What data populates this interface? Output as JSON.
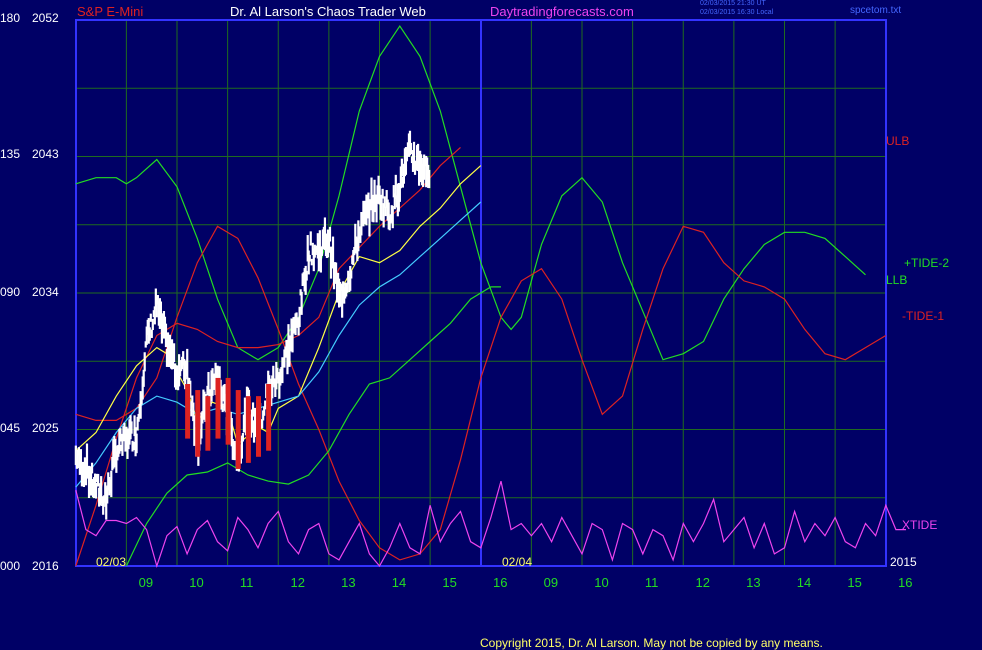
{
  "header": {
    "symbol": "S&P E-Mini",
    "site_title": "Dr. Al Larson's Chaos Trader Web",
    "site_url": "Daytradingforecasts.com",
    "stamp_line1": "02/03/2015 21:30 UT",
    "stamp_line2": "02/03/2015 16:30 Local",
    "file_name": "spcetom.txt"
  },
  "footer": {
    "copyright": "Copyright 2015, Dr. Al Larson. May not be copied by any means."
  },
  "colors": {
    "background": "#000066",
    "grid": "#1f6b1f",
    "frame": "#3333ff",
    "green": "#22dd22",
    "red": "#dd2222",
    "magenta": "#ee44ee",
    "cyan": "#44ccff",
    "yellow": "#ffff44",
    "white": "#ffffff"
  },
  "chart_data": {
    "type": "line",
    "left_axis_labels": [
      {
        "y": 0,
        "label": "000",
        "price": "2016"
      },
      {
        "y": 45,
        "label": "045",
        "price": "2025"
      },
      {
        "y": 90,
        "label": "090",
        "price": "2034"
      },
      {
        "y": 135,
        "label": "135",
        "price": "2043"
      },
      {
        "y": 180,
        "label": "180",
        "price": "2052"
      }
    ],
    "ylim": [
      0,
      180
    ],
    "price_range": [
      2016,
      2052
    ],
    "x_ticks": [
      "09",
      "10",
      "11",
      "12",
      "13",
      "14",
      "15",
      "16",
      "09",
      "10",
      "11",
      "12",
      "13",
      "14",
      "15",
      "16"
    ],
    "date_labels": [
      {
        "t": 0,
        "label": "02/03"
      },
      {
        "t": 8,
        "label": "02/04"
      }
    ],
    "year_label": "2015",
    "xlim": [
      0,
      16
    ],
    "series_labels": [
      {
        "name": "ULB",
        "color": "red"
      },
      {
        "name": "+TIDE-2",
        "color": "green"
      },
      {
        "name": "LLB",
        "color": "green"
      },
      {
        "name": "-TIDE-1",
        "color": "red"
      },
      {
        "name": "XTIDE",
        "color": "magenta"
      }
    ],
    "series": [
      {
        "key": "tide2",
        "color": "green",
        "points": [
          [
            -0.4,
            126
          ],
          [
            0,
            128
          ],
          [
            0.4,
            128
          ],
          [
            0.6,
            126
          ],
          [
            0.8,
            128
          ],
          [
            1.2,
            134
          ],
          [
            1.6,
            125
          ],
          [
            2,
            108
          ],
          [
            2.4,
            88
          ],
          [
            2.8,
            72
          ],
          [
            3.2,
            68
          ],
          [
            3.6,
            72
          ],
          [
            4,
            82
          ],
          [
            4.4,
            98
          ],
          [
            4.8,
            122
          ],
          [
            5.2,
            150
          ],
          [
            5.6,
            168
          ],
          [
            6,
            178
          ],
          [
            6.4,
            168
          ],
          [
            6.8,
            150
          ],
          [
            7.2,
            125
          ],
          [
            7.6,
            100
          ],
          [
            8,
            82
          ],
          [
            8.2,
            78
          ],
          [
            8.4,
            82
          ],
          [
            8.8,
            106
          ],
          [
            9.2,
            122
          ],
          [
            9.6,
            128
          ],
          [
            10,
            120
          ],
          [
            10.4,
            100
          ],
          [
            10.8,
            84
          ],
          [
            11.2,
            68
          ],
          [
            11.6,
            70
          ],
          [
            12,
            74
          ],
          [
            12.4,
            88
          ],
          [
            12.8,
            98
          ],
          [
            13.2,
            106
          ],
          [
            13.6,
            110
          ],
          [
            14,
            110
          ],
          [
            14.4,
            108
          ],
          [
            14.8,
            102
          ],
          [
            15.2,
            96
          ]
        ]
      },
      {
        "key": "tide1",
        "color": "red",
        "points": [
          [
            -0.4,
            50
          ],
          [
            0,
            48
          ],
          [
            0.4,
            48
          ],
          [
            0.8,
            52
          ],
          [
            1.2,
            62
          ],
          [
            1.6,
            82
          ],
          [
            2,
            100
          ],
          [
            2.4,
            112
          ],
          [
            2.8,
            108
          ],
          [
            3.2,
            95
          ],
          [
            3.6,
            78
          ],
          [
            4,
            60
          ],
          [
            4.4,
            45
          ],
          [
            4.8,
            28
          ],
          [
            5.2,
            15
          ],
          [
            5.6,
            6
          ],
          [
            6,
            2
          ],
          [
            6.4,
            4
          ],
          [
            6.8,
            12
          ],
          [
            7.2,
            35
          ],
          [
            7.6,
            62
          ],
          [
            8,
            82
          ],
          [
            8.4,
            94
          ],
          [
            8.8,
            98
          ],
          [
            9.2,
            88
          ],
          [
            9.6,
            68
          ],
          [
            10,
            50
          ],
          [
            10.4,
            56
          ],
          [
            10.8,
            78
          ],
          [
            11.2,
            98
          ],
          [
            11.6,
            112
          ],
          [
            12,
            110
          ],
          [
            12.4,
            100
          ],
          [
            12.8,
            94
          ],
          [
            13.2,
            92
          ],
          [
            13.6,
            88
          ],
          [
            14,
            78
          ],
          [
            14.4,
            70
          ],
          [
            14.8,
            68
          ],
          [
            15.2,
            72
          ],
          [
            15.6,
            76
          ]
        ]
      },
      {
        "key": "ulb",
        "color": "red",
        "points": [
          [
            -0.4,
            0
          ],
          [
            0,
            20
          ],
          [
            0.4,
            42
          ],
          [
            0.8,
            62
          ],
          [
            1.2,
            76
          ],
          [
            1.6,
            80
          ],
          [
            2,
            78
          ],
          [
            2.4,
            74
          ],
          [
            2.8,
            72
          ],
          [
            3.2,
            72
          ],
          [
            3.6,
            73
          ],
          [
            4,
            76
          ],
          [
            4.4,
            82
          ],
          [
            4.8,
            98
          ],
          [
            5.2,
            105
          ],
          [
            5.6,
            112
          ],
          [
            6,
            118
          ],
          [
            6.4,
            124
          ],
          [
            6.8,
            132
          ],
          [
            7.2,
            138
          ]
        ]
      },
      {
        "key": "llb",
        "color": "green",
        "points": [
          [
            0.6,
            0
          ],
          [
            1,
            14
          ],
          [
            1.4,
            24
          ],
          [
            1.8,
            30
          ],
          [
            2.2,
            31
          ],
          [
            2.6,
            34
          ],
          [
            3,
            30
          ],
          [
            3.4,
            28
          ],
          [
            3.8,
            27
          ],
          [
            4.2,
            30
          ],
          [
            4.6,
            38
          ],
          [
            5,
            50
          ],
          [
            5.4,
            60
          ],
          [
            5.8,
            62
          ],
          [
            6.2,
            68
          ],
          [
            6.6,
            74
          ],
          [
            7,
            80
          ],
          [
            7.4,
            88
          ],
          [
            7.8,
            92
          ],
          [
            8,
            92
          ]
        ]
      },
      {
        "key": "xtide",
        "color": "magenta",
        "points": [
          [
            -0.4,
            25
          ],
          [
            -0.2,
            12
          ],
          [
            0,
            10
          ],
          [
            0.2,
            15
          ],
          [
            0.4,
            15
          ],
          [
            0.6,
            14
          ],
          [
            0.8,
            16
          ],
          [
            1,
            12
          ],
          [
            1.2,
            0
          ],
          [
            1.4,
            10
          ],
          [
            1.6,
            13
          ],
          [
            1.8,
            4
          ],
          [
            2,
            12
          ],
          [
            2.2,
            15
          ],
          [
            2.4,
            8
          ],
          [
            2.6,
            5
          ],
          [
            2.8,
            16
          ],
          [
            3,
            12
          ],
          [
            3.2,
            6
          ],
          [
            3.4,
            14
          ],
          [
            3.6,
            18
          ],
          [
            3.8,
            8
          ],
          [
            4,
            4
          ],
          [
            4.2,
            12
          ],
          [
            4.4,
            14
          ],
          [
            4.6,
            4
          ],
          [
            4.8,
            2
          ],
          [
            5,
            8
          ],
          [
            5.2,
            14
          ],
          [
            5.4,
            4
          ],
          [
            5.6,
            0
          ],
          [
            5.8,
            6
          ],
          [
            6,
            14
          ],
          [
            6.2,
            6
          ],
          [
            6.4,
            4
          ],
          [
            6.6,
            20
          ],
          [
            6.8,
            8
          ],
          [
            7,
            14
          ],
          [
            7.2,
            18
          ],
          [
            7.4,
            8
          ],
          [
            7.6,
            6
          ],
          [
            7.8,
            16
          ],
          [
            8,
            28
          ],
          [
            8.2,
            12
          ],
          [
            8.4,
            14
          ],
          [
            8.6,
            10
          ],
          [
            8.8,
            14
          ],
          [
            9,
            8
          ],
          [
            9.2,
            16
          ],
          [
            9.4,
            10
          ],
          [
            9.6,
            4
          ],
          [
            9.8,
            14
          ],
          [
            10,
            12
          ],
          [
            10.2,
            2
          ],
          [
            10.4,
            14
          ],
          [
            10.6,
            12
          ],
          [
            10.8,
            4
          ],
          [
            11,
            12
          ],
          [
            11.2,
            10
          ],
          [
            11.4,
            2
          ],
          [
            11.6,
            14
          ],
          [
            11.8,
            8
          ],
          [
            12,
            14
          ],
          [
            12.2,
            22
          ],
          [
            12.4,
            8
          ],
          [
            12.6,
            12
          ],
          [
            12.8,
            16
          ],
          [
            13,
            6
          ],
          [
            13.2,
            14
          ],
          [
            13.4,
            4
          ],
          [
            13.6,
            6
          ],
          [
            13.8,
            18
          ],
          [
            14,
            8
          ],
          [
            14.2,
            14
          ],
          [
            14.4,
            10
          ],
          [
            14.6,
            16
          ],
          [
            14.8,
            8
          ],
          [
            15,
            6
          ],
          [
            15.2,
            14
          ],
          [
            15.4,
            10
          ],
          [
            15.6,
            20
          ],
          [
            15.8,
            12
          ],
          [
            16,
            12
          ]
        ]
      },
      {
        "key": "avg_fast",
        "color": "yellow",
        "points": [
          [
            -0.4,
            38
          ],
          [
            0,
            44
          ],
          [
            0.4,
            56
          ],
          [
            0.8,
            66
          ],
          [
            1.2,
            72
          ],
          [
            1.4,
            70
          ],
          [
            1.8,
            58
          ],
          [
            2,
            48
          ],
          [
            2.3,
            54
          ],
          [
            2.6,
            52
          ],
          [
            2.8,
            40
          ],
          [
            3.2,
            46
          ],
          [
            3.4,
            44
          ],
          [
            3.6,
            52
          ],
          [
            4,
            56
          ],
          [
            4.4,
            72
          ],
          [
            4.8,
            90
          ],
          [
            5.2,
            102
          ],
          [
            5.6,
            100
          ],
          [
            6,
            104
          ],
          [
            6.4,
            112
          ],
          [
            6.8,
            118
          ],
          [
            7.2,
            126
          ],
          [
            7.6,
            132
          ]
        ]
      },
      {
        "key": "avg_slow",
        "color": "cyan",
        "points": [
          [
            -0.4,
            26
          ],
          [
            0,
            34
          ],
          [
            0.4,
            44
          ],
          [
            0.8,
            52
          ],
          [
            1.2,
            56
          ],
          [
            1.6,
            54
          ],
          [
            2,
            50
          ],
          [
            2.4,
            52
          ],
          [
            2.8,
            50
          ],
          [
            3.2,
            52
          ],
          [
            3.6,
            54
          ],
          [
            4,
            56
          ],
          [
            4.4,
            64
          ],
          [
            4.8,
            76
          ],
          [
            5.2,
            86
          ],
          [
            5.6,
            92
          ],
          [
            6,
            96
          ],
          [
            6.4,
            102
          ],
          [
            6.8,
            108
          ],
          [
            7.2,
            114
          ],
          [
            7.6,
            120
          ]
        ]
      }
    ],
    "price_path": [
      [
        -0.4,
        36
      ],
      [
        -0.2,
        32
      ],
      [
        0,
        26
      ],
      [
        0.2,
        22
      ],
      [
        0.4,
        38
      ],
      [
        0.6,
        42
      ],
      [
        0.8,
        44
      ],
      [
        1,
        74
      ],
      [
        1.2,
        86
      ],
      [
        1.4,
        72
      ],
      [
        1.6,
        64
      ],
      [
        1.8,
        66
      ],
      [
        2,
        40
      ],
      [
        2.2,
        56
      ],
      [
        2.4,
        62
      ],
      [
        2.6,
        48
      ],
      [
        2.8,
        36
      ],
      [
        3,
        52
      ],
      [
        3.2,
        44
      ],
      [
        3.4,
        58
      ],
      [
        3.6,
        62
      ],
      [
        3.8,
        72
      ],
      [
        4,
        82
      ],
      [
        4.2,
        104
      ],
      [
        4.4,
        104
      ],
      [
        4.6,
        108
      ],
      [
        4.8,
        88
      ],
      [
        5,
        96
      ],
      [
        5.2,
        110
      ],
      [
        5.4,
        118
      ],
      [
        5.6,
        122
      ],
      [
        5.8,
        116
      ],
      [
        6,
        126
      ],
      [
        6.2,
        136
      ],
      [
        6.4,
        132
      ],
      [
        6.6,
        130
      ]
    ],
    "red_bars": [
      [
        1.8,
        42,
        60
      ],
      [
        2,
        36,
        58
      ],
      [
        2.2,
        38,
        56
      ],
      [
        2.4,
        42,
        62
      ],
      [
        2.6,
        40,
        62
      ],
      [
        2.8,
        32,
        58
      ],
      [
        3,
        34,
        56
      ],
      [
        3.2,
        36,
        56
      ],
      [
        3.4,
        38,
        60
      ]
    ]
  }
}
